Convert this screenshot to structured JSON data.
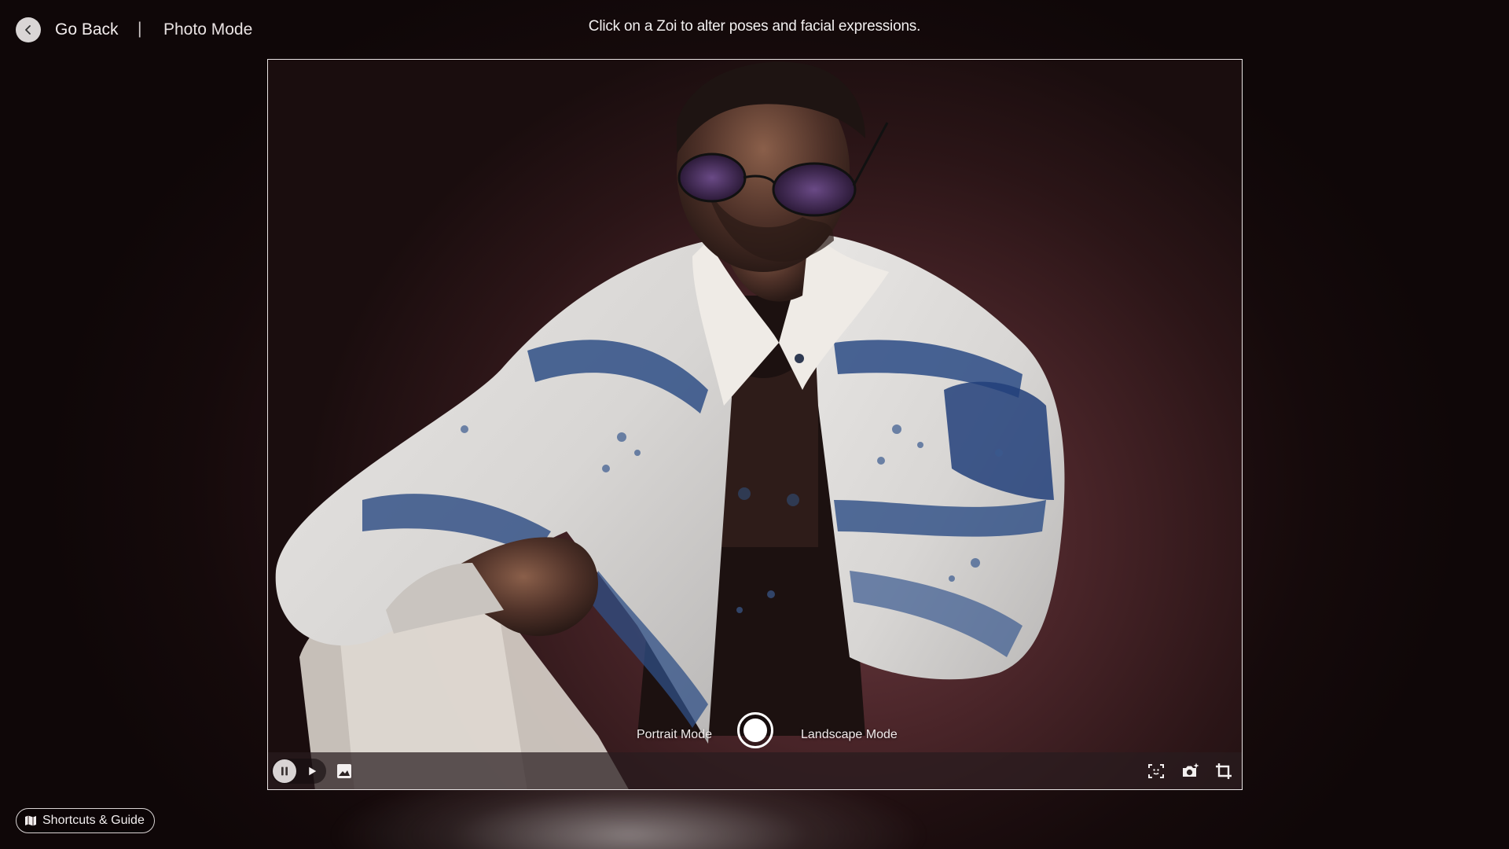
{
  "header": {
    "back_label": "Go Back",
    "separator": "|",
    "mode_title": "Photo Mode",
    "hint": "Click on a Zoi to alter poses and facial expressions."
  },
  "capture": {
    "portrait_label": "Portrait Mode",
    "landscape_label": "Landscape Mode"
  },
  "footer": {
    "shortcuts_label": "Shortcuts & Guide"
  },
  "icons": {
    "back": "chevron-left-icon",
    "pause": "pause-icon",
    "play": "play-icon",
    "gallery": "gallery-icon",
    "focus": "face-focus-icon",
    "camera_effects": "camera-sparkle-icon",
    "crop": "crop-icon",
    "shortcuts": "map-icon"
  },
  "colors": {
    "background": "#1a0d0e",
    "frame_border": "#e9e4e4",
    "text": "#f2eeee"
  }
}
